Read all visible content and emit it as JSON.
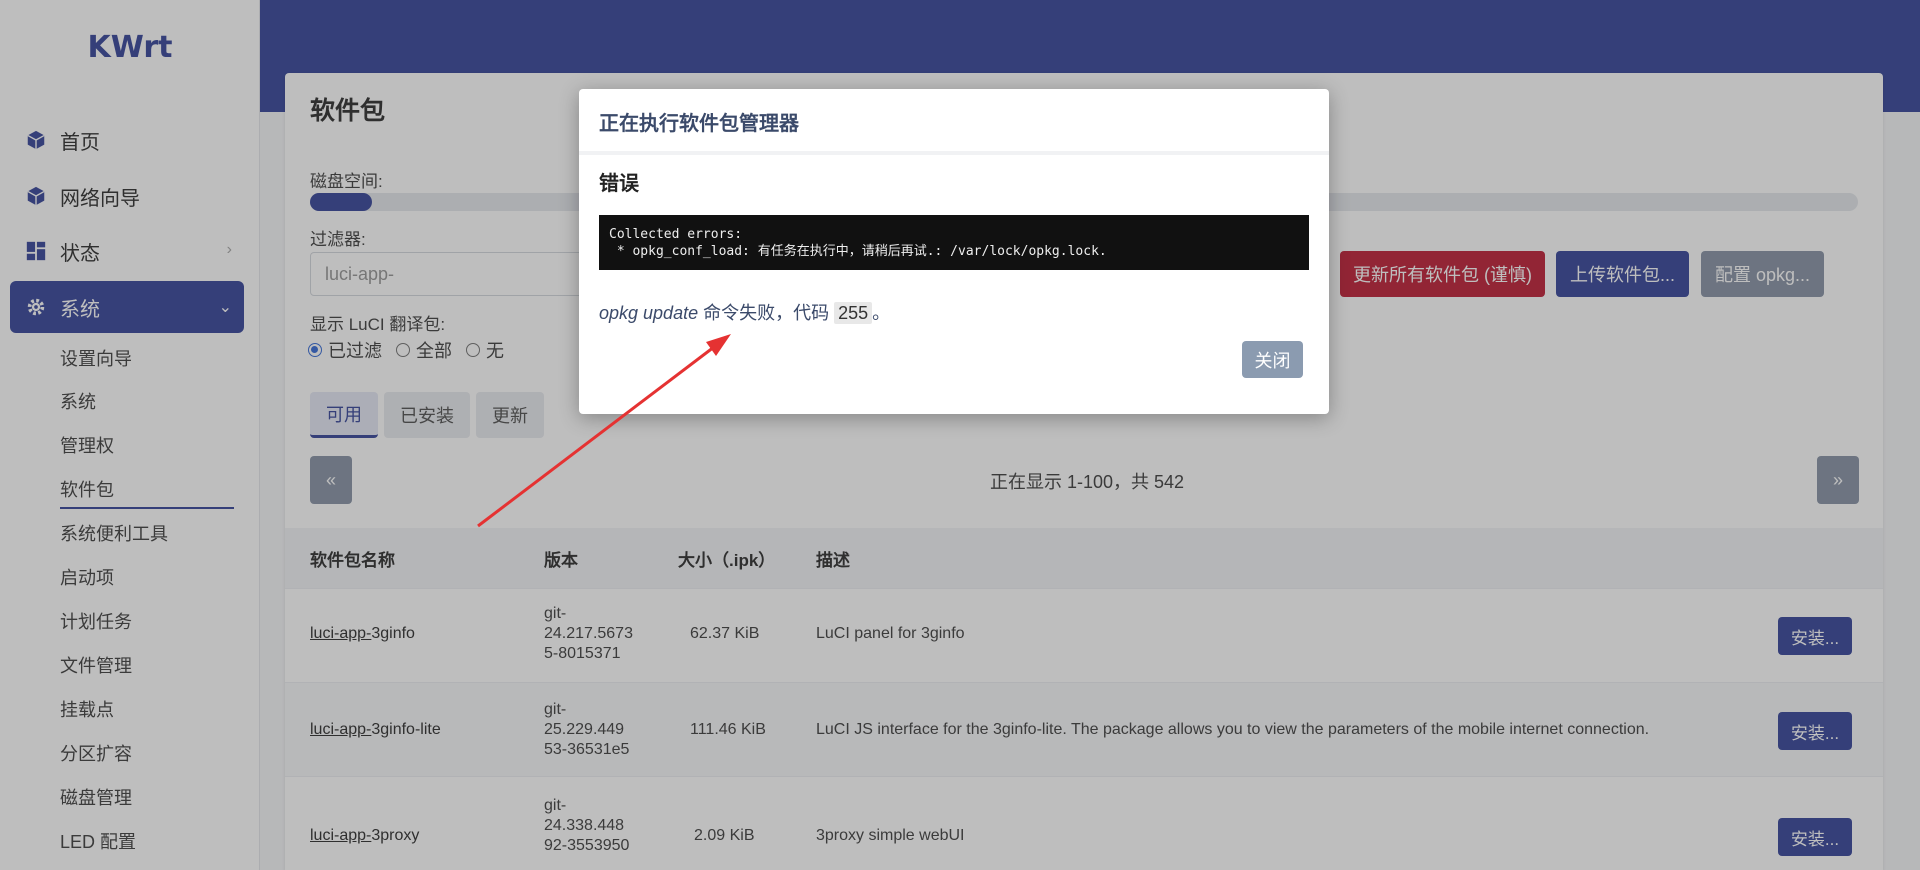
{
  "app": {
    "logo": "KWrt"
  },
  "sidebar": {
    "items": [
      {
        "label": "首页",
        "icon": "cube-icon"
      },
      {
        "label": "网络向导",
        "icon": "cube-icon"
      },
      {
        "label": "状态",
        "icon": "dashboard-icon"
      },
      {
        "label": "系统",
        "icon": "gear-icon"
      }
    ],
    "subitems": [
      "设置向导",
      "系统",
      "管理权",
      "软件包",
      "系统便利工具",
      "启动项",
      "计划任务",
      "文件管理",
      "挂载点",
      "分区扩容",
      "磁盘管理",
      "LED 配置"
    ]
  },
  "page": {
    "title": "软件包",
    "disk_label": "磁盘空间:",
    "disk_usage_fraction": 0.04,
    "filter_label": "过滤器:",
    "filter_value": "luci-app-",
    "translation_label": "显示 LuCI 翻译包:",
    "radio_options": [
      "已过滤",
      "全部",
      "无"
    ],
    "radio_selected": "已过滤",
    "actions": {
      "update_all": "更新所有软件包 (谨慎)",
      "upload": "上传软件包...",
      "configure": "配置 opkg..."
    },
    "tabs": [
      "可用",
      "已安装",
      "更新"
    ],
    "active_tab": "可用",
    "pagination": {
      "prev": "«",
      "next": "»",
      "info": "正在显示 1-100，共 542"
    }
  },
  "table": {
    "headers": [
      "软件包名称",
      "版本",
      "大小（.ipk）",
      "描述"
    ],
    "rows": [
      {
        "name_prefix": "luci-app-",
        "name_suffix": "3ginfo",
        "version": [
          "git-",
          "24.217.5673",
          "5-8015371"
        ],
        "size": "62.37 KiB",
        "description": "LuCI panel for 3ginfo",
        "action": "安装..."
      },
      {
        "name_prefix": "luci-app-",
        "name_suffix": "3ginfo-lite",
        "version": [
          "git-",
          "25.229.449",
          "53-36531e5"
        ],
        "size": "111.46 KiB",
        "description": "LuCI JS interface for the 3ginfo-lite. The package allows you to view the parameters of the mobile internet connection.",
        "action": "安装..."
      },
      {
        "name_prefix": "luci-app-",
        "name_suffix": "3proxy",
        "version": [
          "git-",
          "24.338.448",
          "92-3553950"
        ],
        "size": "2.09 KiB",
        "description": "3proxy simple webUI",
        "action": "安装..."
      }
    ]
  },
  "modal": {
    "title": "正在执行软件包管理器",
    "heading": "错误",
    "console_line1": "Collected errors:",
    "console_line2": " * opkg_conf_load: 有任务在执行中，请稍后再试.: /var/lock/opkg.lock.",
    "message_cmd": "opkg update",
    "message_text": " 命令失败，代码 ",
    "message_code": "255",
    "message_end": "。",
    "close_label": "关闭"
  },
  "colors": {
    "accent": "#3b4a9c",
    "danger": "#c0243b",
    "muted": "#8b96a8",
    "annotation_arrow": "#e53232"
  }
}
